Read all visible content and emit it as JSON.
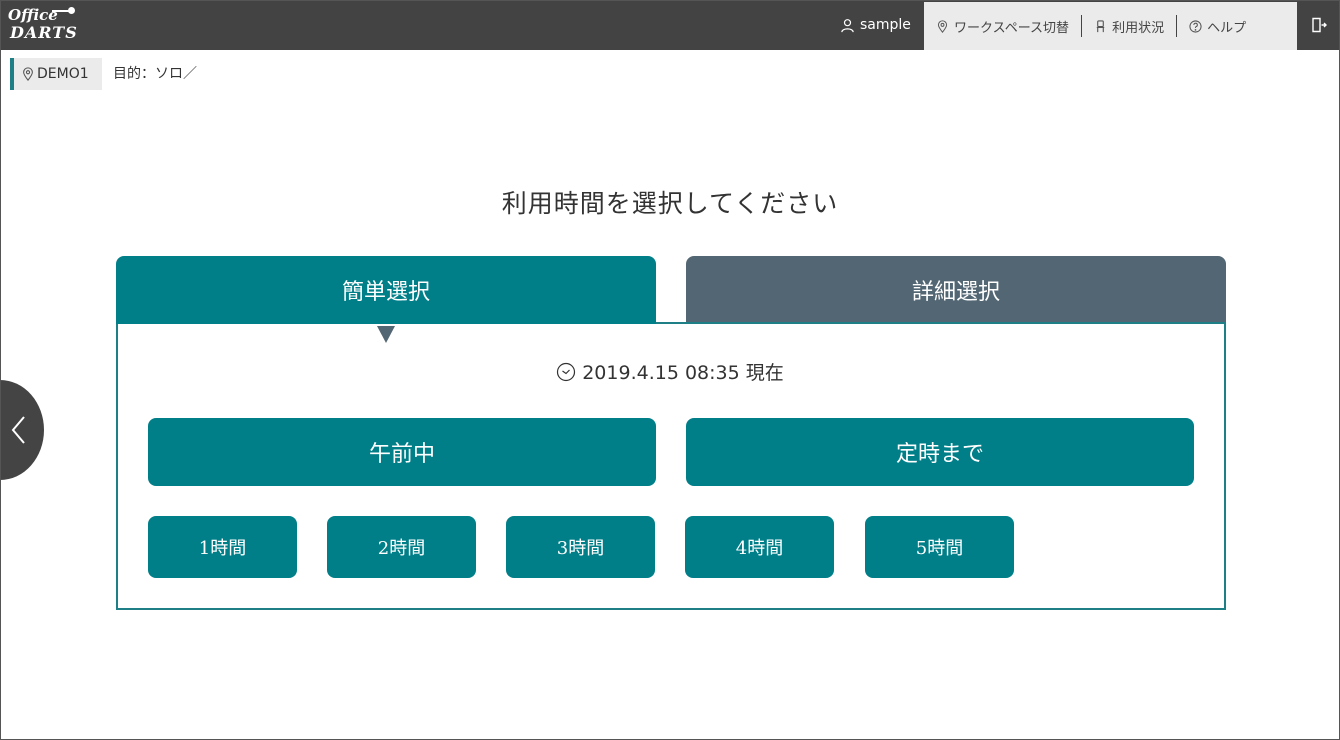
{
  "header": {
    "logo_line1": "Office",
    "logo_line2": "DARTS",
    "user": "sample",
    "nav": {
      "workspace": "ワークスペース切替",
      "usage": "利用状況",
      "help": "ヘルプ"
    },
    "icons": {
      "user": "user-icon",
      "workspace": "location-pin-icon",
      "usage": "chair-icon",
      "help": "question-circle-icon",
      "logout": "logout-icon"
    }
  },
  "breadcrumb": {
    "workspace": "DEMO1",
    "purpose": "目的：ソロ／"
  },
  "page": {
    "title": "利用時間を選択してください",
    "tabs": {
      "simple": "簡単選択",
      "detail": "詳細選択"
    },
    "now": "2019.4.15 08:35 現在",
    "quick_buttons": {
      "morning": "午前中",
      "until_close": "定時まで"
    },
    "hour_buttons": [
      "1時間",
      "2時間",
      "3時間",
      "4時間",
      "5時間"
    ]
  },
  "colors": {
    "accent": "#007f89",
    "tab_inactive": "#536673",
    "header": "#434343"
  }
}
